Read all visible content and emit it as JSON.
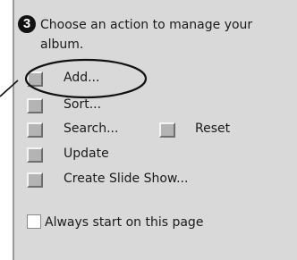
{
  "panel": {
    "step_number": "3",
    "heading": "Choose an action to manage your album."
  },
  "actions": {
    "add": "Add...",
    "sort": "Sort...",
    "search": "Search...",
    "reset": "Reset",
    "update": "Update",
    "create_slide_show": "Create Slide Show..."
  },
  "options": {
    "always_start_label": "Always start on this page",
    "always_start_checked": false
  }
}
